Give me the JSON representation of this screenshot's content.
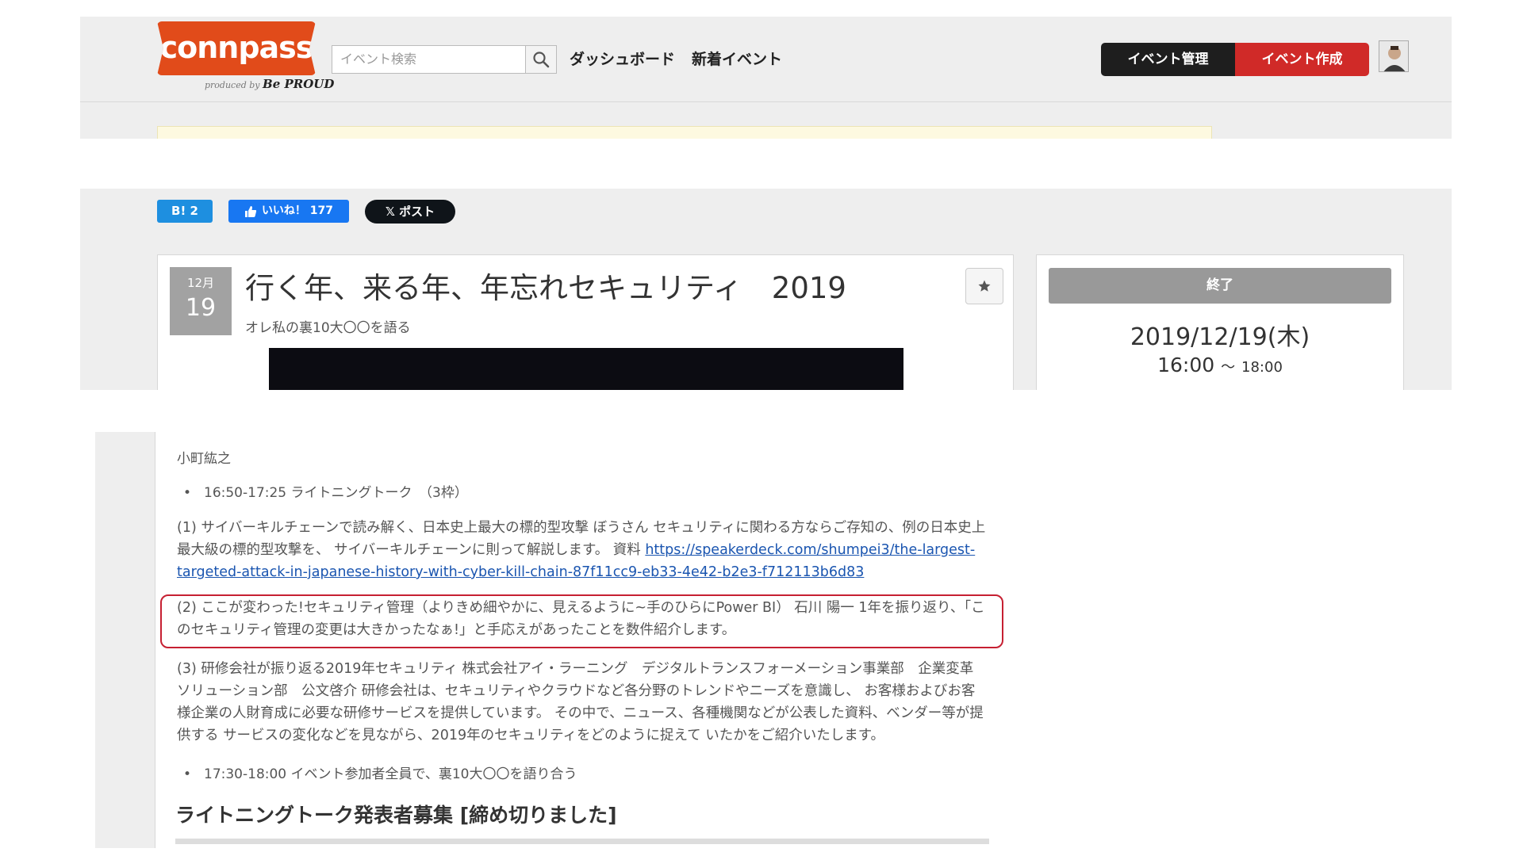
{
  "header": {
    "logo_text": "connpass",
    "logo_sub": "produced by",
    "logo_brand": "Be PROUD",
    "search_placeholder": "イベント検索",
    "nav": [
      "ダッシュボード",
      "新着イベント"
    ],
    "manage_label": "イベント管理",
    "create_label": "イベント作成"
  },
  "social": {
    "hatebu": "B! 2",
    "like": "いいね！ 177",
    "post": "𝕏 ポスト"
  },
  "event": {
    "month": "12月",
    "day": "19",
    "title": "行く年、来る年、年忘れセキュリティ　2019",
    "subtitle": "オレ私の裏10大〇〇を語る"
  },
  "side": {
    "status": "終了",
    "date": "2019/12/19(木)",
    "time_start": "16:00",
    "time_sep": "～",
    "time_end": "18:00"
  },
  "description": {
    "speaker": "小町紘之",
    "bullet_1": "16:50-17:25 ライトニングトーク　（3枠）",
    "para_1_text": "(1) サイバーキルチェーンで読み解く、日本史上最大の標的型攻撃 ぼうさん セキュリティに関わる方ならご存知の、例の日本史上最大級の標的型攻撃を、 サイバーキルチェーンに則って解説します。 資料 ",
    "para_1_link": "https://speakerdeck.com/shumpei3/the-largest-targeted-attack-in-japanese-history-with-cyber-kill-chain-87f11cc9-eb33-4e42-b2e3-f712113b6d83",
    "para_2": "(2) ここが変わった!セキュリティ管理（よりきめ細やかに、見えるように~手のひらにPower BI） 石川 陽一 1年を振り返り、「このセキュリティ管理の変更は大きかったなぁ!」と手応えがあったことを数件紹介します。",
    "para_3": "(3) 研修会社が振り返る2019年セキュリティ 株式会社アイ・ラーニング　デジタルトランスフォーメーション事業部　企業変革ソリューション部　公文啓介 研修会社は、セキュリティやクラウドなど各分野のトレンドやニーズを意識し、 お客様およびお客様企業の人財育成に必要な研修サービスを提供しています。 その中で、ニュース、各種機関などが公表した資料、ベンダー等が提供する サービスの変化などを見ながら、2019年のセキュリティをどのように捉えて いたかをご紹介いたします。",
    "bullet_2": "17:30-18:00 イベント参加者全員で、裏10大〇〇を語り合う",
    "heading": "ライトニングトーク発表者募集 [締め切りました]"
  },
  "colors": {
    "logo": "#e14b1a",
    "create_button": "#d02a28",
    "highlight_border": "#c62032",
    "link": "#1a55b0"
  }
}
